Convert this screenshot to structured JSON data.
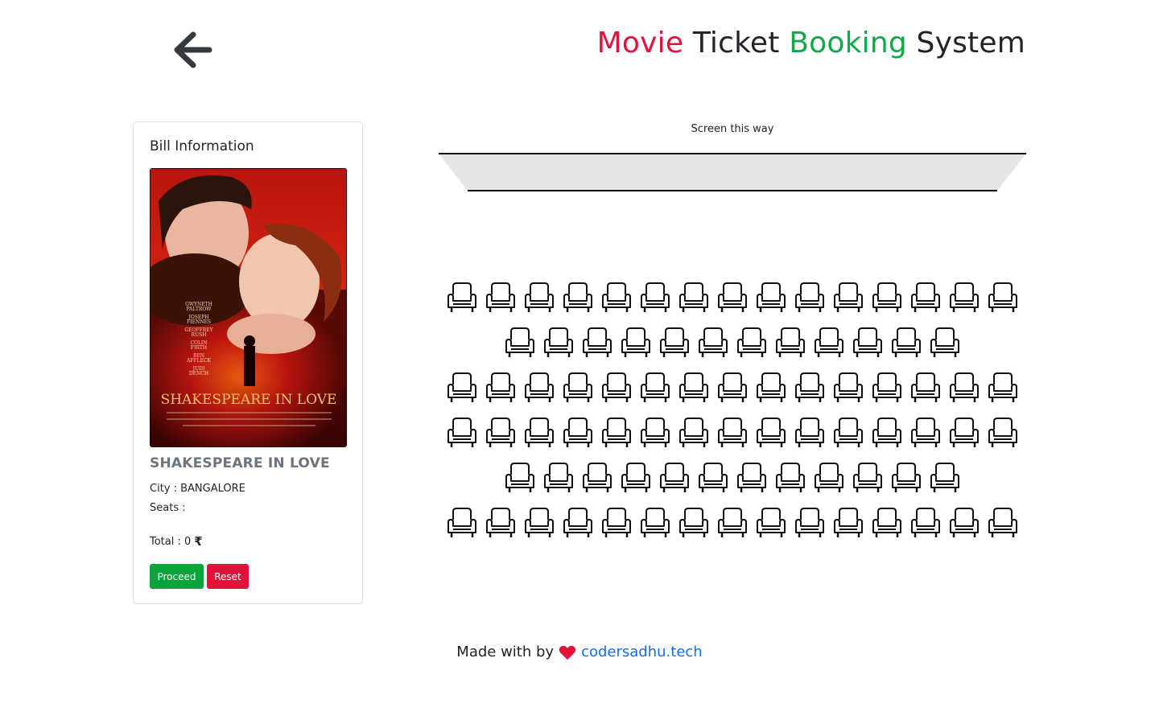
{
  "header": {
    "title_words": [
      "Movie",
      "Ticket",
      "Booking",
      "System"
    ],
    "back_icon": "arrow-left-icon"
  },
  "bill": {
    "title": "Bill Information",
    "poster_title_text": "SHAKESPEARE IN LOVE",
    "poster_credits": [
      "GWYNETH PALTROW",
      "JOSEPH FIENNES",
      "GEOFFREY RUSH",
      "COLIN FIRTH",
      "BEN AFFLECK",
      "JUDI DENCH"
    ],
    "movie_name": "SHAKESPEARE IN LOVE",
    "city_label": "City : BANGALORE",
    "seats_label": "Seats :",
    "total_label": "Total : 0",
    "currency_icon": "rupee-icon",
    "proceed_label": "Proceed",
    "reset_label": "Reset"
  },
  "screen": {
    "label": "Screen this way"
  },
  "seating": {
    "rows": [
      15,
      12,
      15,
      15,
      12,
      15
    ],
    "seat_icon": "armchair-icon"
  },
  "footer": {
    "prefix": "Made with by",
    "heart_icon": "heart-icon",
    "link_text": "codersadhu.tech"
  },
  "colors": {
    "red": "#e2133a",
    "green": "#12a84a",
    "link": "#0d6efd"
  }
}
